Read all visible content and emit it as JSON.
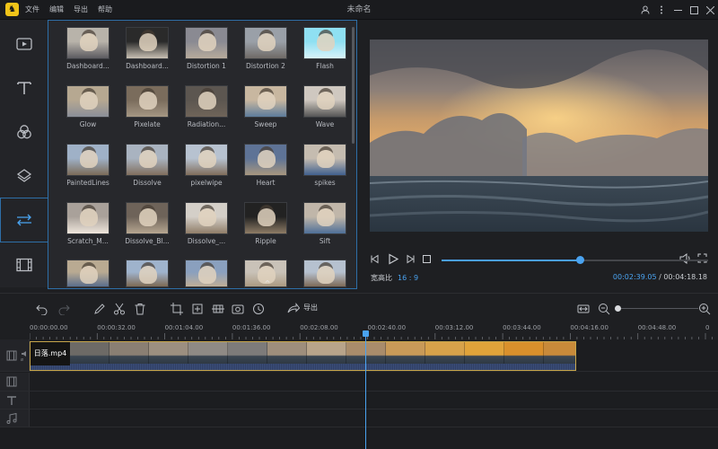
{
  "app": {
    "title": "未命名",
    "logo_icon": "app-logo-icon"
  },
  "menu": [
    {
      "label": "文件"
    },
    {
      "label": "编辑"
    },
    {
      "label": "导出"
    },
    {
      "label": "帮助"
    }
  ],
  "window_controls": [
    {
      "icon": "user-icon"
    },
    {
      "icon": "more-icon"
    },
    {
      "icon": "minimize-icon"
    },
    {
      "icon": "maximize-icon"
    },
    {
      "icon": "close-icon"
    }
  ],
  "sidebar": [
    {
      "icon": "media-icon",
      "active": false
    },
    {
      "icon": "text-icon",
      "active": false
    },
    {
      "icon": "filters-icon",
      "active": false
    },
    {
      "icon": "overlays-icon",
      "active": false
    },
    {
      "icon": "transitions-icon",
      "active": true
    },
    {
      "icon": "film-icon",
      "active": false
    }
  ],
  "transitions": [
    {
      "label": "Dashboard..."
    },
    {
      "label": "Dashboard..."
    },
    {
      "label": "Distortion 1"
    },
    {
      "label": "Distortion 2"
    },
    {
      "label": "Flash"
    },
    {
      "label": "Glow"
    },
    {
      "label": "Pixelate"
    },
    {
      "label": "Radiation..."
    },
    {
      "label": "Sweep"
    },
    {
      "label": "Wave"
    },
    {
      "label": "PaintedLines"
    },
    {
      "label": "Dissolve"
    },
    {
      "label": "pixelwipe"
    },
    {
      "label": "Heart"
    },
    {
      "label": "spikes"
    },
    {
      "label": "Scratch_M..."
    },
    {
      "label": "Dissolve_Bl..."
    },
    {
      "label": "Dissolve_..."
    },
    {
      "label": "Ripple"
    },
    {
      "label": "Sift"
    },
    {
      "label": ""
    },
    {
      "label": ""
    },
    {
      "label": ""
    },
    {
      "label": ""
    },
    {
      "label": ""
    }
  ],
  "player": {
    "aspect_label": "宽高比",
    "aspect_value": "16 : 9",
    "current_time": "00:02:39.05",
    "separator": " / ",
    "total_time": "00:04:18.18",
    "progress": 0.52
  },
  "toolbar": {
    "export_label": "导出"
  },
  "ruler": [
    "00:00:00.00",
    "00:00:32.00",
    "00:01:04.00",
    "00:01:36.00",
    "00:02:08.00",
    "00:02:40.00",
    "00:03:12.00",
    "00:03:44.00",
    "00:04:16.00",
    "00:04:48.00",
    "0"
  ],
  "clip": {
    "name": "日落.mp4"
  },
  "colors": {
    "accent": "#4aa3f0",
    "clip_border": "#c6a54a",
    "panel_border": "#2e6fa8"
  }
}
